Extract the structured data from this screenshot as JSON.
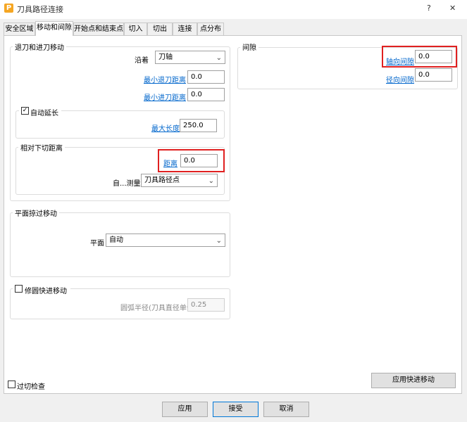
{
  "window": {
    "title": "刀具路径连接",
    "help_label": "?",
    "close_label": "✕"
  },
  "tabs": [
    "安全区域",
    "移动和间隙",
    "开始点和结束点",
    "切入",
    "切出",
    "连接",
    "点分布"
  ],
  "retract": {
    "title": "退刀和进刀移动",
    "along_label": "沿着",
    "along_value": "刀轴",
    "min_retract_label": "最小退刀距离",
    "min_retract_value": "0.0",
    "min_plunge_label": "最小进刀距离",
    "min_plunge_value": "0.0",
    "auto_extend_label": "自动延长",
    "auto_extend_checked": true,
    "max_length_label": "最大长度",
    "max_length_value": "250.0",
    "relative_title": "相对下切距离",
    "distance_label": "距离",
    "distance_value": "0.0",
    "measure_label": "自...测量",
    "measure_value": "刀具路径点"
  },
  "clearance": {
    "title": "间隙",
    "axial_label": "轴向间隙",
    "axial_value": "0.0",
    "radial_label": "径向间隙",
    "radial_value": "0.0"
  },
  "skim": {
    "title": "平面掠过移动",
    "plane_label": "平面",
    "plane_value": "自动"
  },
  "arc_rapid": {
    "label": "修圆快进移动",
    "checked": false,
    "radius_label": "圆弧半径(刀具直径单位)",
    "radius_value": "0.25"
  },
  "gouge_check": {
    "label": "过切检查",
    "checked": false
  },
  "buttons": {
    "apply_rapid": "应用快进移动",
    "apply": "应用",
    "accept": "接受",
    "cancel": "取消"
  },
  "colors": {
    "accent": "#0078d7",
    "link": "#0066cc",
    "highlight": "#e02020"
  },
  "icons": {
    "checked": "✓",
    "dropdown": "⌄"
  }
}
